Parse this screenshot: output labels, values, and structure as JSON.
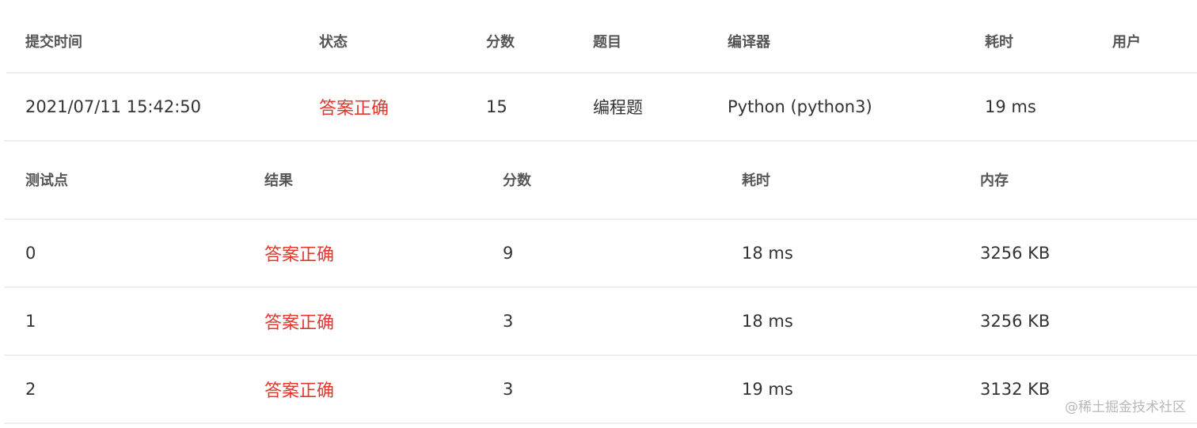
{
  "submission": {
    "headers": {
      "time": "提交时间",
      "status": "状态",
      "score": "分数",
      "problem": "题目",
      "compiler": "编译器",
      "elapsed": "耗时",
      "user": "用户"
    },
    "row": {
      "time": "2021/07/11 15:42:50",
      "status": "答案正确",
      "score": "15",
      "problem": "编程题",
      "compiler": "Python (python3)",
      "elapsed": "19 ms",
      "user": ""
    }
  },
  "testpoints": {
    "headers": {
      "point": "测试点",
      "result": "结果",
      "score": "分数",
      "elapsed": "耗时",
      "memory": "内存"
    },
    "rows": [
      {
        "point": "0",
        "result": "答案正确",
        "score": "9",
        "elapsed": "18 ms",
        "memory": "3256 KB"
      },
      {
        "point": "1",
        "result": "答案正确",
        "score": "3",
        "elapsed": "18 ms",
        "memory": "3256 KB"
      },
      {
        "point": "2",
        "result": "答案正确",
        "score": "3",
        "elapsed": "19 ms",
        "memory": "3132 KB"
      }
    ]
  },
  "colors": {
    "accepted": "#e0382f",
    "header_text": "#555555",
    "body_text": "#333333",
    "divider": "#eeeeee"
  },
  "watermark": "@稀土掘金技术社区"
}
